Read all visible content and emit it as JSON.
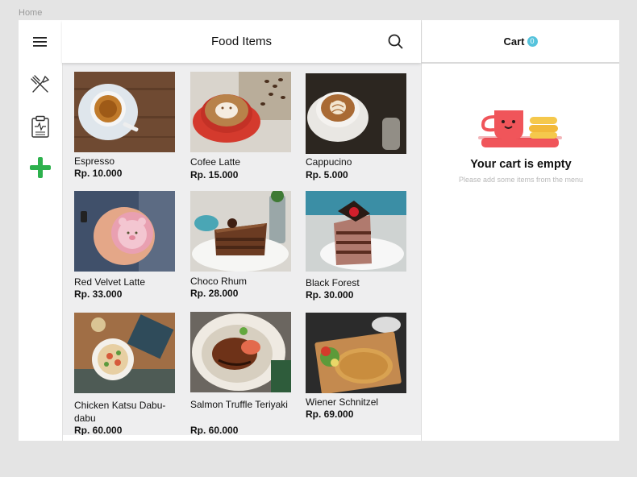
{
  "breadcrumb": "Home",
  "header": {
    "title": "Food Items"
  },
  "cart": {
    "label": "Cart",
    "count": "0",
    "empty_title": "Your cart is empty",
    "empty_subtitle": "Please add some items from the menu"
  },
  "sidebar": {
    "items": [
      {
        "icon": "utensils-icon"
      },
      {
        "icon": "clipboard-icon"
      },
      {
        "icon": "plus-icon"
      }
    ]
  },
  "colors": {
    "accent_green": "#2db14d",
    "badge": "#56c3dc",
    "cup_red": "#f0555a",
    "pancake": "#f5c84c"
  },
  "items": [
    {
      "name": "Espresso",
      "price": "Rp. 10.000"
    },
    {
      "name": "Cofee Latte",
      "price": "Rp. 15.000"
    },
    {
      "name": "Cappucino",
      "price": "Rp. 5.000"
    },
    {
      "name": "Red Velvet Latte",
      "price": "Rp. 33.000"
    },
    {
      "name": "Choco Rhum",
      "price": "Rp. 28.000"
    },
    {
      "name": "Black Forest",
      "price": "Rp. 30.000"
    },
    {
      "name": "Chicken Katsu Dabu-dabu",
      "price": "Rp. 60.000"
    },
    {
      "name": "Salmon Truffle Teriyaki",
      "price": "Rp. 60.000"
    },
    {
      "name": "Wiener Schnitzel",
      "price": "Rp. 69.000"
    }
  ]
}
